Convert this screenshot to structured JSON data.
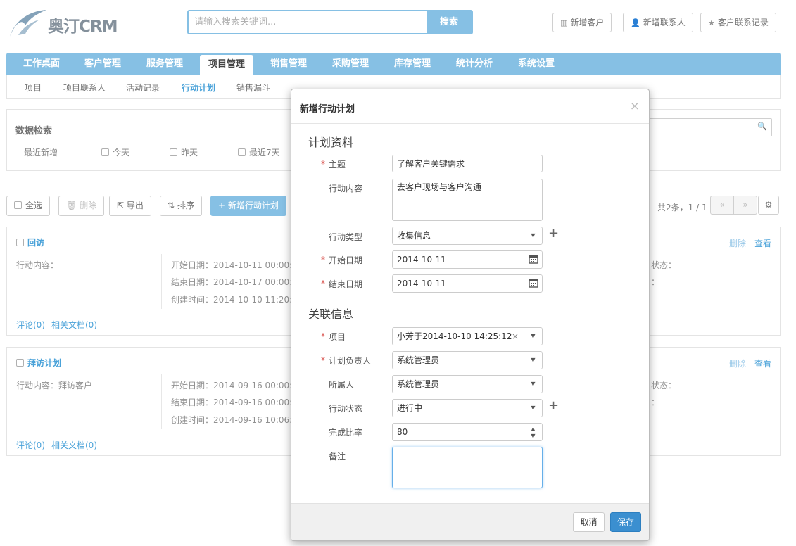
{
  "app": {
    "logo_text": "奥汀CRM"
  },
  "search": {
    "placeholder": "请输入搜索关键词...",
    "button": "搜索"
  },
  "top_actions": [
    {
      "label": "新增客户",
      "icon": "building-icon"
    },
    {
      "label": "新增联系人",
      "icon": "user-icon"
    },
    {
      "label": "客户联系记录",
      "icon": "star-icon"
    }
  ],
  "nav": {
    "items": [
      "工作桌面",
      "客户管理",
      "服务管理",
      "项目管理",
      "销售管理",
      "采购管理",
      "库存管理",
      "统计分析",
      "系统设置"
    ],
    "active": "项目管理"
  },
  "subnav": {
    "items": [
      "项目",
      "项目联系人",
      "活动记录",
      "行动计划",
      "销售漏斗"
    ],
    "active": "行动计划"
  },
  "filter": {
    "title": "数据检索",
    "row_label": "最近新增",
    "options": [
      "今天",
      "昨天",
      "最近7天"
    ]
  },
  "toolbar": {
    "select_all": "全选",
    "delete": "删除",
    "export": "导出",
    "sort": "排序",
    "add": "新增行动计划",
    "pager_text": "共2条，1 / 1",
    "prev": "«",
    "next": "»"
  },
  "cards": [
    {
      "title": "回访",
      "content_label": "行动内容：",
      "start": "开始日期：2014-10-11 00:00:00",
      "end": "结束日期：2014-10-17 00:00:00",
      "created": "创建时间：2014-10-10 11:20:02",
      "status_label": "状态：",
      "extra": "：",
      "delete": "删除",
      "view": "查看",
      "comments": "评论(0)",
      "docs": "相关文档(0)"
    },
    {
      "title": "拜访计划",
      "content_label": "行动内容：拜访客户",
      "start": "开始日期：2014-09-16 00:00:00",
      "end": "结束日期：2014-09-16 00:00:00",
      "created": "创建时间：2014-09-16 10:06:18",
      "status_label": "状态：",
      "extra": "：",
      "delete": "删除",
      "view": "查看",
      "comments": "评论(0)",
      "docs": "相关文档(0)"
    }
  ],
  "modal": {
    "title": "新增行动计划",
    "close": "×",
    "section1": "计划资料",
    "section2": "关联信息",
    "fields": {
      "subject": {
        "label": "主题",
        "value": "了解客户关键需求"
      },
      "content": {
        "label": "行动内容",
        "value": "去客户现场与客户沟通"
      },
      "type": {
        "label": "行动类型",
        "value": "收集信息"
      },
      "start_date": {
        "label": "开始日期",
        "value": "2014-10-11"
      },
      "end_date": {
        "label": "结束日期",
        "value": "2014-10-11"
      },
      "project": {
        "label": "项目",
        "value": "小芳于2014-10-10 14:25:12创建"
      },
      "owner": {
        "label": "计划负责人",
        "value": "系统管理员"
      },
      "belongs": {
        "label": "所属人",
        "value": "系统管理员"
      },
      "status": {
        "label": "行动状态",
        "value": "进行中"
      },
      "rate": {
        "label": "完成比率",
        "value": "80"
      },
      "remark": {
        "label": "备注",
        "value": ""
      }
    },
    "required_mark": "*",
    "add_icon": "+",
    "cancel": "取消",
    "save": "保存"
  },
  "colors": {
    "primary": "#7cbbe2",
    "link": "#3b9bd6",
    "save": "#3b8fd0",
    "required": "#d9534f"
  }
}
